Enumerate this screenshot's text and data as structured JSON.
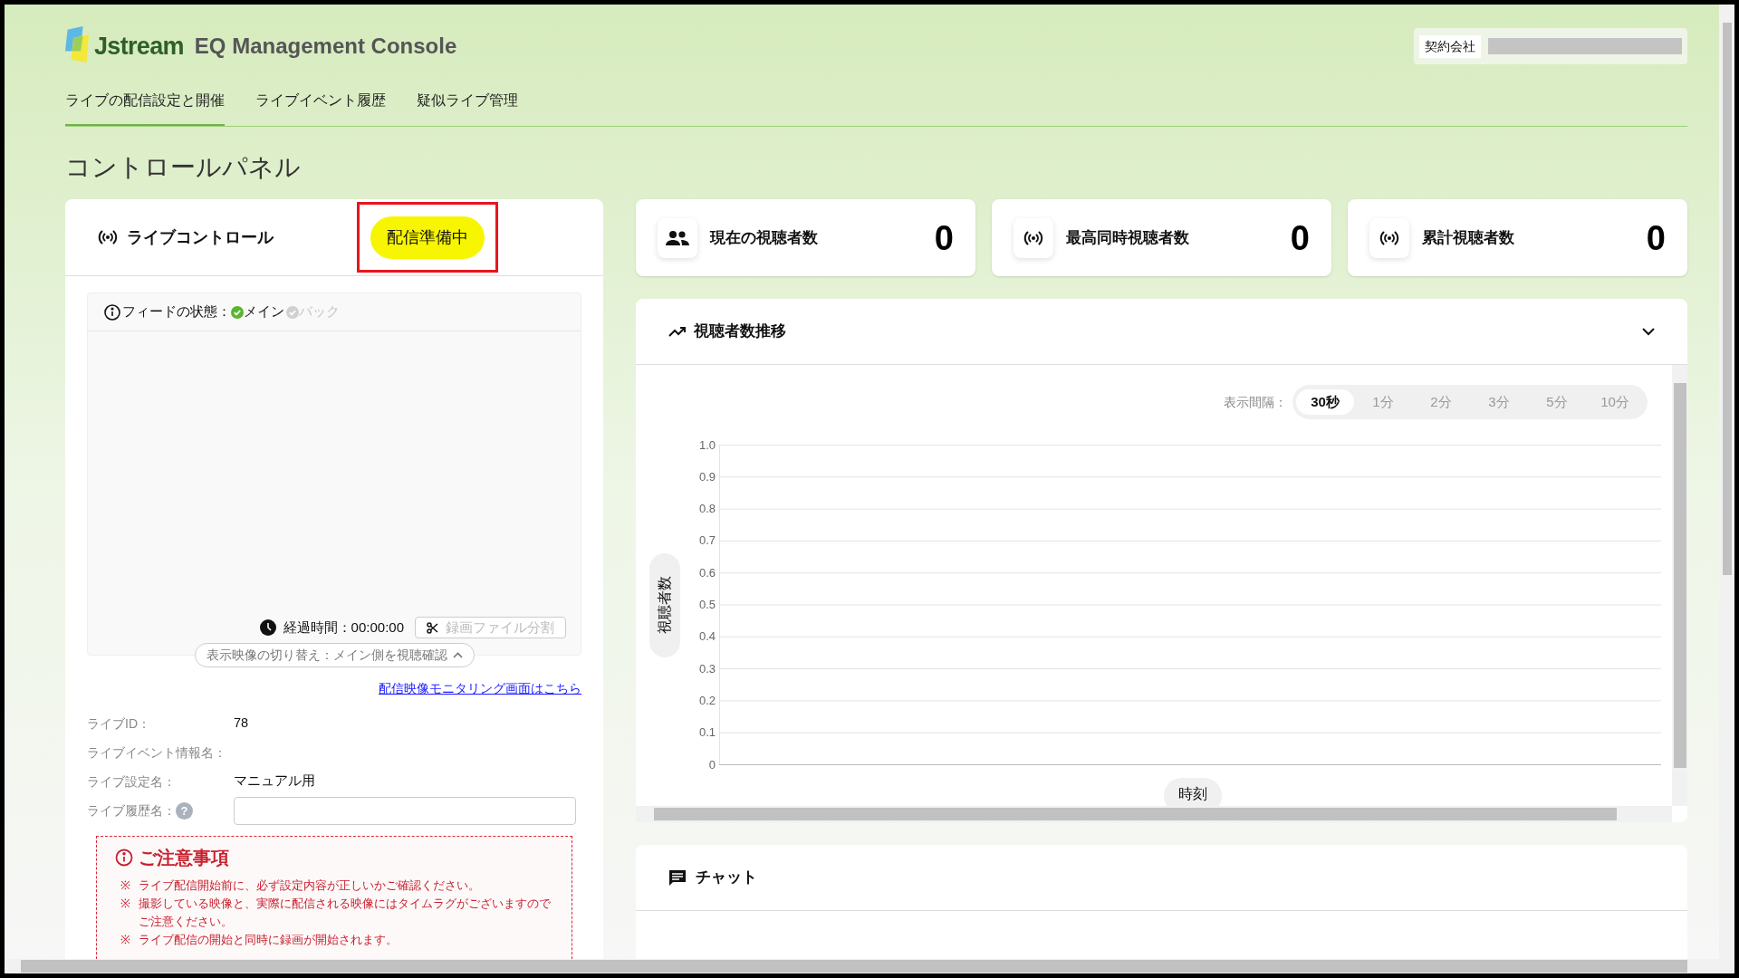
{
  "header": {
    "logo_text": "Jstream",
    "app_title": "EQ Management Console",
    "contract": {
      "label": "契約会社"
    }
  },
  "nav": [
    {
      "label": "ライブの配信設定と開催",
      "selected": true
    },
    {
      "label": "ライブイベント履歴",
      "selected": false
    },
    {
      "label": "疑似ライブ管理",
      "selected": false
    }
  ],
  "page_title": "コントロールパネル",
  "live_control": {
    "title": "ライブコントロール",
    "status": "配信準備中",
    "status_highlighted": true,
    "feed": {
      "label": "フィードの状態：",
      "sources": [
        {
          "label": "メイン",
          "on": true
        },
        {
          "label": "バック",
          "on": false
        }
      ]
    },
    "elapsed": "経過時間：00:00:00",
    "split_button": {
      "label": "録画ファイル分割",
      "disabled": true
    },
    "view_toggle": "表示映像の切り替え：メイン側を視聴確認",
    "monitor_link": "配信映像モニタリング画面はこちら",
    "fields": [
      {
        "kind": "text",
        "label": "ライブID：",
        "value": "78"
      },
      {
        "kind": "text",
        "label": "ライブイベント情報名："
      },
      {
        "kind": "text",
        "label": "ライブ設定名：",
        "value": "マニュアル用"
      },
      {
        "kind": "input",
        "label": "ライブ履歴名：",
        "help": "?"
      }
    ],
    "notice": {
      "title": "ご注意事項",
      "items": [
        {
          "mark": "※",
          "text": "ライブ配信開始前に、必ず設定内容が正しいかご確認ください。"
        },
        {
          "mark": "※",
          "text": "撮影している映像と、実際に配信される映像にはタイムラグがございますのでご注意ください。"
        },
        {
          "mark": "※",
          "text": "ライブ配信の開始と同時に録画が開始されます。"
        }
      ]
    }
  },
  "stats": [
    {
      "kind": "people",
      "label": "現在の視聴者数",
      "value": "0"
    },
    {
      "kind": "broadcast",
      "label": "最高同時視聴者数",
      "value": "0"
    },
    {
      "kind": "broadcast",
      "label": "累計視聴者数",
      "value": "0"
    }
  ],
  "viewer_trend": {
    "title": "視聴者数推移",
    "interval_label": "表示間隔：",
    "intervals": [
      {
        "label": "30秒",
        "selected": true
      },
      {
        "label": "1分",
        "selected": false
      },
      {
        "label": "2分",
        "selected": false
      },
      {
        "label": "3分",
        "selected": false
      },
      {
        "label": "5分",
        "selected": false
      },
      {
        "label": "10分",
        "selected": false
      }
    ],
    "empty_chart": {
      "y_axis_title": "視聴者数",
      "y_axis_labels": [
        "1.0",
        "0.9",
        "0.8",
        "0.7",
        "0.6",
        "0.5",
        "0.4",
        "0.3",
        "0.2",
        "0.1",
        "0"
      ],
      "x_axis_title": "時刻"
    }
  },
  "chat": {
    "title": "チャット"
  }
}
